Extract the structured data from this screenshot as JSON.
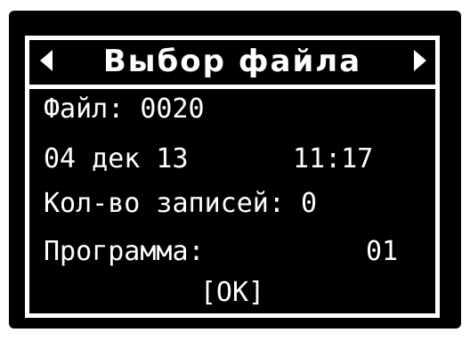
{
  "header": {
    "title": "Выбор файла",
    "prev_icon": "triangle-left-icon",
    "next_icon": "triangle-right-icon"
  },
  "file": {
    "label_value": "Файл: 0020"
  },
  "datetime": {
    "date": "04 дек 13",
    "time": "11:17"
  },
  "records": {
    "label_value": "Кол-во записей: 0"
  },
  "program": {
    "label": "Программа:",
    "value": "01"
  },
  "ok_button": {
    "label": "[OK]"
  },
  "colors": {
    "background": "#000000",
    "foreground": "#ffffff"
  }
}
